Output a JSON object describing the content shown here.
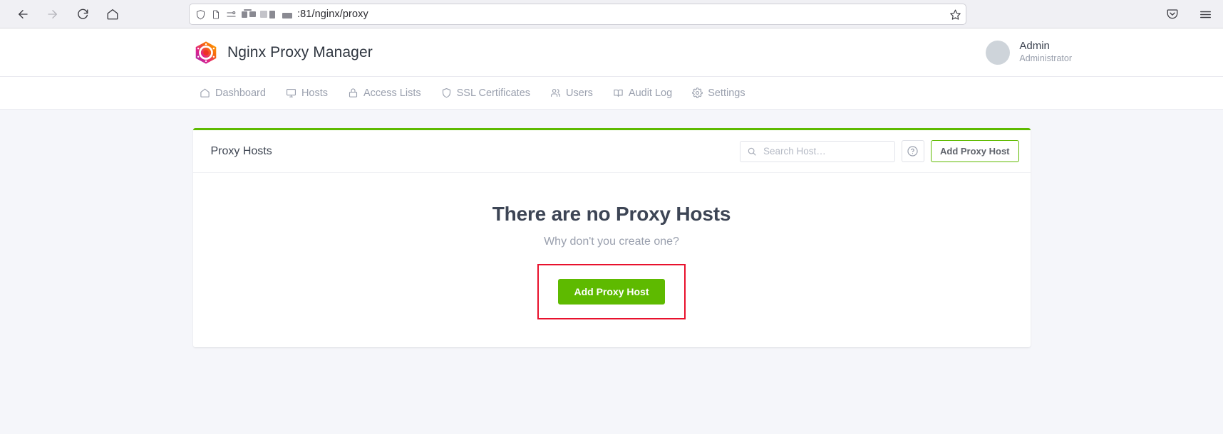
{
  "browser": {
    "back_icon": "arrow-left-icon",
    "forward_icon": "arrow-right-icon",
    "reload_icon": "reload-icon",
    "home_icon": "home-icon",
    "shield_icon": "shield-icon",
    "page_icon": "page-icon",
    "permissions_icon": "permissions-icon",
    "url_text": ":81/nginx/proxy",
    "url_redacted": true,
    "bookmark_icon": "star-icon",
    "pocket_icon": "pocket-icon",
    "menu_icon": "hamburger-menu-icon"
  },
  "app": {
    "brand_title": "Nginx Proxy Manager",
    "user": {
      "name": "Admin",
      "role": "Administrator"
    },
    "nav": [
      {
        "label": "Dashboard",
        "icon": "home-icon"
      },
      {
        "label": "Hosts",
        "icon": "monitor-icon"
      },
      {
        "label": "Access Lists",
        "icon": "lock-icon"
      },
      {
        "label": "SSL Certificates",
        "icon": "shield-icon"
      },
      {
        "label": "Users",
        "icon": "users-icon"
      },
      {
        "label": "Audit Log",
        "icon": "book-icon"
      },
      {
        "label": "Settings",
        "icon": "gear-icon"
      }
    ]
  },
  "card": {
    "title": "Proxy Hosts",
    "accent_color": "#5eba00",
    "search": {
      "placeholder": "Search Host…",
      "value": "",
      "icon": "search-icon"
    },
    "help_icon": "question-circle-icon",
    "add_button_label": "Add Proxy Host"
  },
  "empty_state": {
    "title": "There are no Proxy Hosts",
    "subtitle": "Why don't you create one?",
    "cta_label": "Add Proxy Host",
    "highlight_color": "#e8112d"
  }
}
